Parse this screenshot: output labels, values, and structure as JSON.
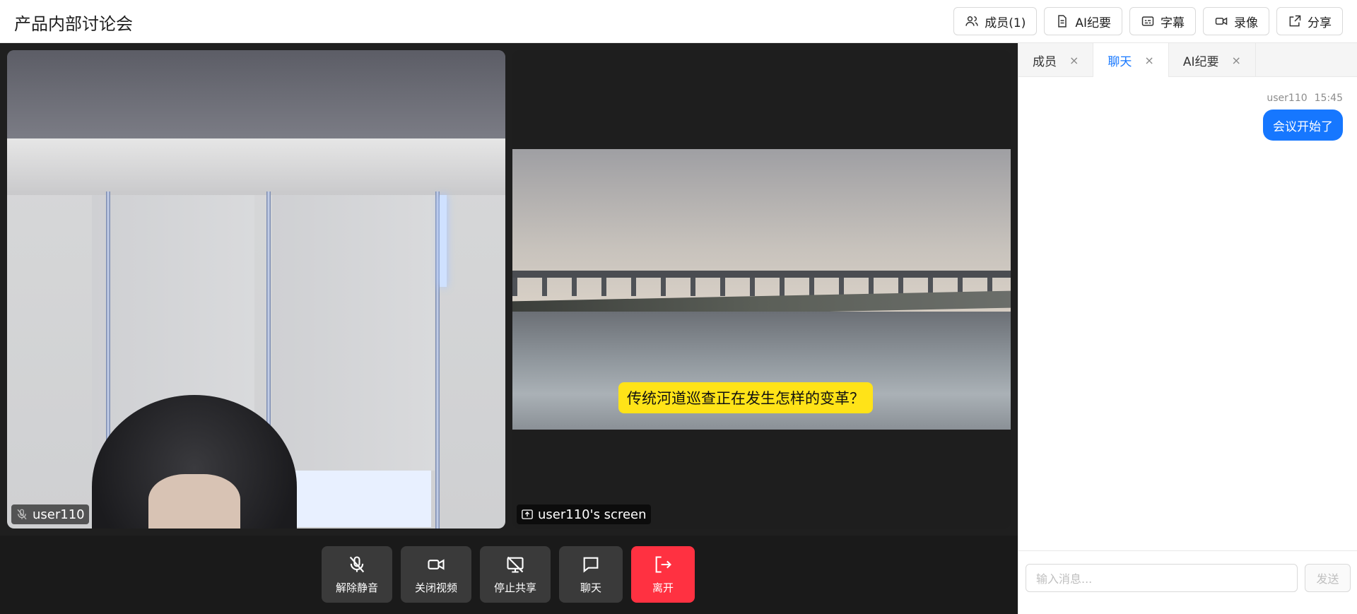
{
  "header": {
    "title": "产品内部讨论会",
    "buttons": [
      {
        "label": "成员(1)",
        "icon": "users-icon"
      },
      {
        "label": "AI纪要",
        "icon": "document-icon"
      },
      {
        "label": "字幕",
        "icon": "captions-icon"
      },
      {
        "label": "录像",
        "icon": "video-record-icon"
      },
      {
        "label": "分享",
        "icon": "share-icon"
      }
    ]
  },
  "stage": {
    "camera_tile": {
      "name": "user110",
      "icon": "mic-muted-icon"
    },
    "screen_tile": {
      "name": "user110's screen",
      "icon": "screen-share-icon",
      "caption": "传统河道巡查正在发生怎样的变革？"
    }
  },
  "controls": [
    {
      "label": "解除静音",
      "icon": "mic-off-icon"
    },
    {
      "label": "关闭视频",
      "icon": "video-icon"
    },
    {
      "label": "停止共享",
      "icon": "stop-share-icon"
    },
    {
      "label": "聊天",
      "icon": "chat-icon"
    },
    {
      "label": "离开",
      "icon": "leave-icon",
      "color": "#ff3141"
    }
  ],
  "panel": {
    "tabs": [
      {
        "label": "成员",
        "active": false
      },
      {
        "label": "聊天",
        "active": true
      },
      {
        "label": "AI纪要",
        "active": false
      }
    ],
    "close_glyph": "×",
    "messages": [
      {
        "user": "user110",
        "time": "15:45",
        "text": "会议开始了"
      }
    ],
    "composer": {
      "placeholder": "输入消息...",
      "send_label": "发送"
    }
  },
  "colors": {
    "accent": "#1677ff",
    "danger": "#ff3141",
    "caption_bg": "#ffe318"
  }
}
